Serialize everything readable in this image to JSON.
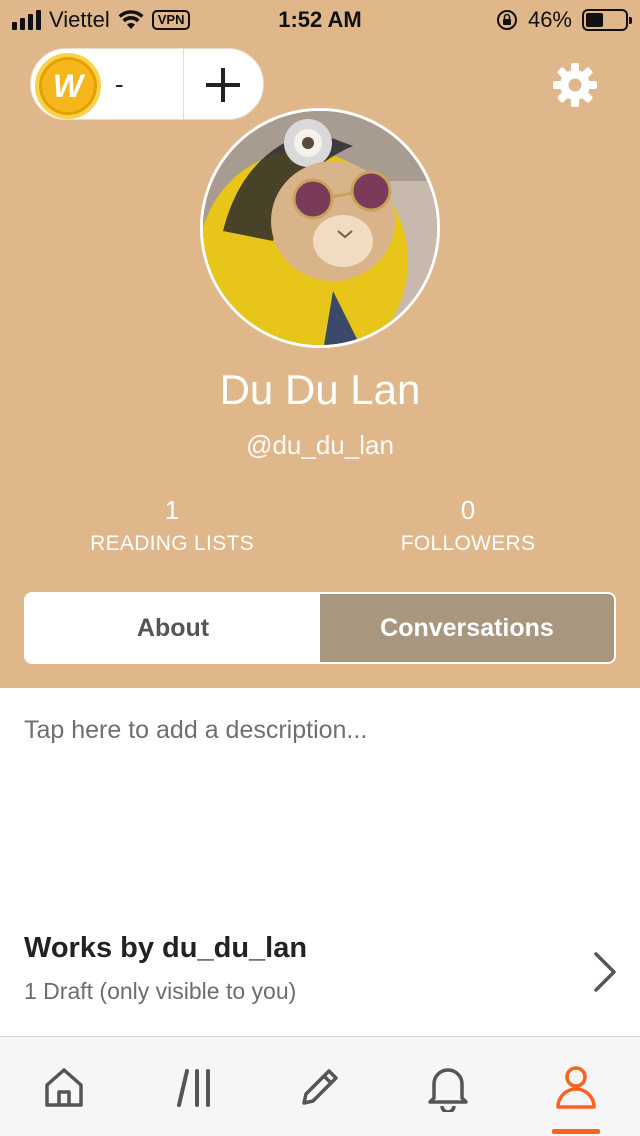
{
  "status_bar": {
    "carrier": "Viettel",
    "vpn": "VPN",
    "time": "1:52 AM",
    "battery": "46%",
    "battery_level": 0.46
  },
  "wallet": {
    "coin_symbol": "W",
    "coin_count": "-",
    "add_icon": "plus-icon"
  },
  "settings": {
    "icon": "gear-icon"
  },
  "profile": {
    "display_name": "Du Du Lan",
    "username": "@du_du_lan",
    "stats": [
      {
        "value": "1",
        "label": "READING LISTS"
      },
      {
        "value": "0",
        "label": "FOLLOWERS"
      }
    ]
  },
  "tabs": [
    {
      "label": "About",
      "selected": false
    },
    {
      "label": "Conversations",
      "selected": true
    }
  ],
  "about": {
    "placeholder": "Tap here to add a description..."
  },
  "works": {
    "title": "Works by du_du_lan",
    "subtitle": "1 Draft (only visible to you)"
  },
  "bottom_nav": {
    "items": [
      "home-icon",
      "library-icon",
      "write-icon",
      "notifications-icon",
      "profile-icon"
    ],
    "active": "profile-icon"
  },
  "colors": {
    "header_bg": "#dfb78a",
    "tab_selected_bg": "#a9967f",
    "accent": "#ff6122"
  }
}
